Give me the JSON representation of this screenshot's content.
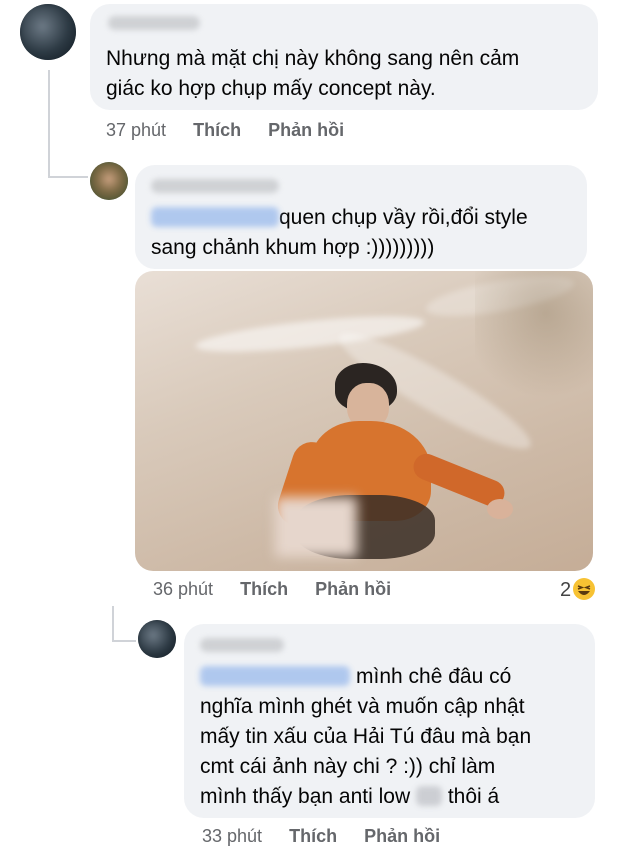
{
  "comments": [
    {
      "text": "Nhưng mà mặt chị này không sang nên cảm giác ko hợp chụp mấy concept này.",
      "line1": "Nhưng mà mặt chị này không sang nên cảm",
      "line2": "giác ko hợp chụp mấy concept này.",
      "time": "37 phút",
      "like": "Thích",
      "reply": "Phản hồi"
    },
    {
      "line1": "quen chụp vầy rồi,đổi style",
      "line2": "sang chảnh khum hợp :)))))))))",
      "time": "36 phút",
      "like": "Thích",
      "reply": "Phản hồi",
      "reaction_count": "2",
      "reaction_icon": "haha-emoji-icon"
    },
    {
      "line1": "mình chê đâu có",
      "line2": "nghĩa mình ghét và muốn cập nhật",
      "line3": "mấy tin xấu của Hải Tú đâu mà bạn",
      "line4": "cmt cái ảnh này chi ? :)) chỉ làm",
      "line5a": "mình thấy bạn anti low",
      "line5b": "thôi á",
      "time": "33 phút",
      "like": "Thích",
      "reply": "Phản hồi"
    }
  ],
  "colors": {
    "bubble": "#f0f2f5",
    "meta": "#65676b",
    "text": "#050505",
    "thread_line": "#d0d3d8",
    "haha": "#f7c233"
  }
}
